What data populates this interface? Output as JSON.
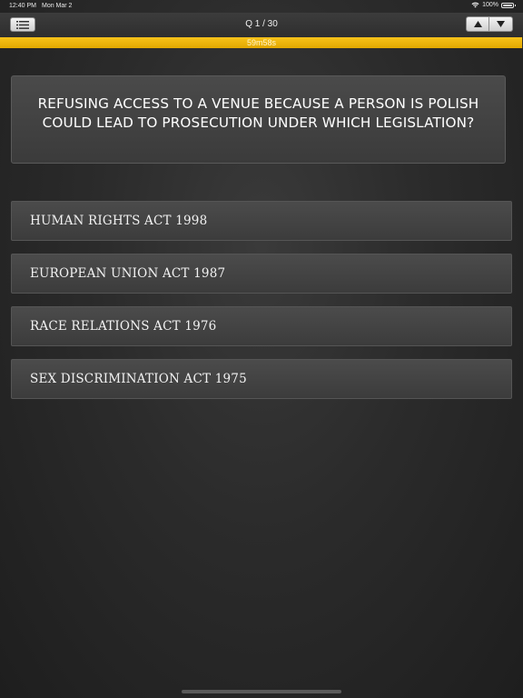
{
  "status_bar": {
    "time": "12:40 PM",
    "date": "Mon Mar 2",
    "battery": "100%"
  },
  "nav": {
    "menu_icon": "list-icon",
    "counter": "Q 1 / 30",
    "up_icon": "arrow-up-icon",
    "down_icon": "arrow-down-icon"
  },
  "timer": {
    "label": "59m58s",
    "remaining_fraction": 0.999
  },
  "question": {
    "text": "REFUSING ACCESS TO A VENUE BECAUSE A PERSON IS POLISH COULD LEAD TO PROSECUTION UNDER WHICH LEGISLATION?"
  },
  "answers": [
    {
      "label": "HUMAN RIGHTS ACT 1998"
    },
    {
      "label": "EUROPEAN UNION ACT 1987"
    },
    {
      "label": "RACE RELATIONS ACT 1976"
    },
    {
      "label": "SEX DISCRIMINATION ACT 1975"
    }
  ],
  "colors": {
    "timer_accent": "#f2b90f",
    "background": "#2b2b2b"
  }
}
